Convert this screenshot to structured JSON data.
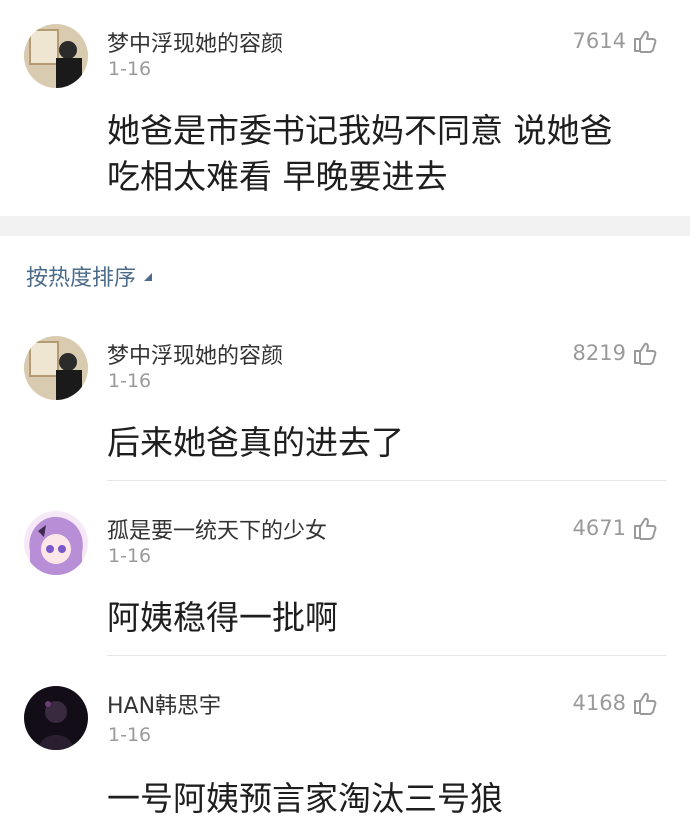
{
  "top_comment": {
    "user": "梦中浮现她的容颜",
    "date": "1-16",
    "likes": "7614",
    "text_line1": "她爸是市委书记我妈不同意 说她爸",
    "text_line2": "吃相太难看 早晚要进去"
  },
  "sort_label": "按热度排序",
  "replies": [
    {
      "user": "梦中浮现她的容颜",
      "date": "1-16",
      "likes": "8219",
      "text": "后来她爸真的进去了"
    },
    {
      "user": "孤是要一统天下的少女",
      "date": "1-16",
      "likes": "4671",
      "text": "阿姨稳得一批啊"
    },
    {
      "user": "HAN韩思宇",
      "date": "1-16",
      "likes": "4168",
      "text": "一号阿姨预言家淘汰三号狼"
    }
  ],
  "colors": {
    "link": "#4a6b8a",
    "muted": "#9a9a9a",
    "band": "#f2f2f2"
  }
}
